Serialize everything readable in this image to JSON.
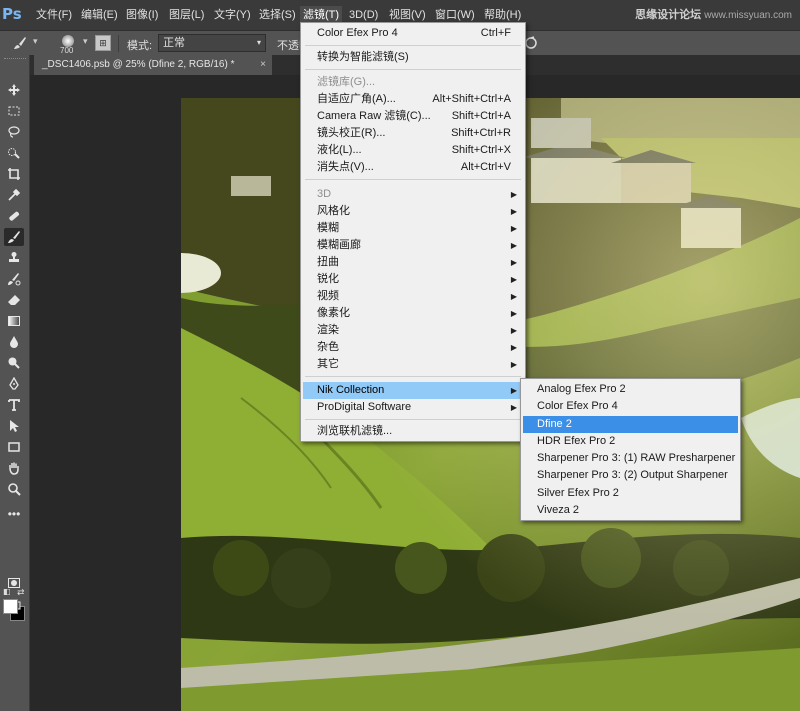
{
  "app": {
    "logo": "Ps",
    "watermark_cn": "思缘设计论坛",
    "watermark_url": "www.missyuan.com"
  },
  "menubar": {
    "items": [
      {
        "label": "文件(F)"
      },
      {
        "label": "编辑(E)"
      },
      {
        "label": "图像(I)"
      },
      {
        "label": "图层(L)"
      },
      {
        "label": "文字(Y)"
      },
      {
        "label": "选择(S)"
      },
      {
        "label": "滤镜(T)"
      },
      {
        "label": "3D(D)"
      },
      {
        "label": "视图(V)"
      },
      {
        "label": "窗口(W)"
      },
      {
        "label": "帮助(H)"
      }
    ],
    "active_index": 6
  },
  "options": {
    "brush_size": "700",
    "mode_label": "模式:",
    "mode_value": "正常",
    "opacity_label": "不透明"
  },
  "document": {
    "tab_title": "_DSC1406.psb @ 25% (Dfine 2, RGB/16) *",
    "close_glyph": "×"
  },
  "filter_menu": {
    "items": [
      {
        "label": "Color Efex Pro 4",
        "shortcut": "Ctrl+F"
      },
      {
        "label": "转换为智能滤镜(S)"
      },
      {
        "label": "滤镜库(G)...",
        "disabled": true
      },
      {
        "label": "自适应广角(A)...",
        "shortcut": "Alt+Shift+Ctrl+A"
      },
      {
        "label": "Camera Raw 滤镜(C)...",
        "shortcut": "Shift+Ctrl+A"
      },
      {
        "label": "镜头校正(R)...",
        "shortcut": "Shift+Ctrl+R"
      },
      {
        "label": "液化(L)...",
        "shortcut": "Shift+Ctrl+X"
      },
      {
        "label": "消失点(V)...",
        "shortcut": "Alt+Ctrl+V"
      },
      {
        "label": "3D",
        "disabled": true,
        "submenu": true
      },
      {
        "label": "风格化",
        "submenu": true
      },
      {
        "label": "模糊",
        "submenu": true
      },
      {
        "label": "模糊画廊",
        "submenu": true
      },
      {
        "label": "扭曲",
        "submenu": true
      },
      {
        "label": "锐化",
        "submenu": true
      },
      {
        "label": "视频",
        "submenu": true
      },
      {
        "label": "像素化",
        "submenu": true
      },
      {
        "label": "渲染",
        "submenu": true
      },
      {
        "label": "杂色",
        "submenu": true
      },
      {
        "label": "其它",
        "submenu": true
      },
      {
        "label": "Nik Collection",
        "submenu": true,
        "highlighted": true
      },
      {
        "label": "ProDigital Software",
        "submenu": true
      },
      {
        "label": "浏览联机滤镜..."
      }
    ]
  },
  "nik_submenu": {
    "items": [
      {
        "label": "Analog Efex Pro 2"
      },
      {
        "label": "Color Efex Pro 4"
      },
      {
        "label": "Dfine 2",
        "highlighted": true
      },
      {
        "label": "HDR Efex Pro 2"
      },
      {
        "label": "Sharpener Pro 3: (1) RAW Presharpener"
      },
      {
        "label": "Sharpener Pro 3: (2) Output Sharpener"
      },
      {
        "label": "Silver Efex Pro 2"
      },
      {
        "label": "Viveza 2"
      }
    ]
  },
  "toolbar": {
    "tools": [
      {
        "icon": "move-icon"
      },
      {
        "icon": "marquee-icon"
      },
      {
        "icon": "lasso-icon"
      },
      {
        "icon": "quick-select-icon"
      },
      {
        "icon": "crop-icon"
      },
      {
        "icon": "eyedropper-icon"
      },
      {
        "icon": "healing-icon"
      },
      {
        "icon": "brush-icon",
        "selected": true
      },
      {
        "icon": "clone-stamp-icon"
      },
      {
        "icon": "history-brush-icon"
      },
      {
        "icon": "eraser-icon"
      },
      {
        "icon": "gradient-icon"
      },
      {
        "icon": "blur-icon"
      },
      {
        "icon": "dodge-icon"
      },
      {
        "icon": "pen-icon"
      },
      {
        "icon": "type-icon"
      },
      {
        "icon": "path-select-icon"
      },
      {
        "icon": "rectangle-icon"
      },
      {
        "icon": "hand-icon"
      },
      {
        "icon": "zoom-icon"
      },
      {
        "icon": "more-tools-icon"
      }
    ],
    "foreground_color": "#ffffff",
    "background_color": "#000000"
  },
  "colors": {
    "menubar_bg": "#3a3a3a",
    "panel_bg": "#535353",
    "menu_bg": "#f0f0f0",
    "highlight_light": "#91c9f7",
    "highlight_strong": "#3c8fe6"
  }
}
